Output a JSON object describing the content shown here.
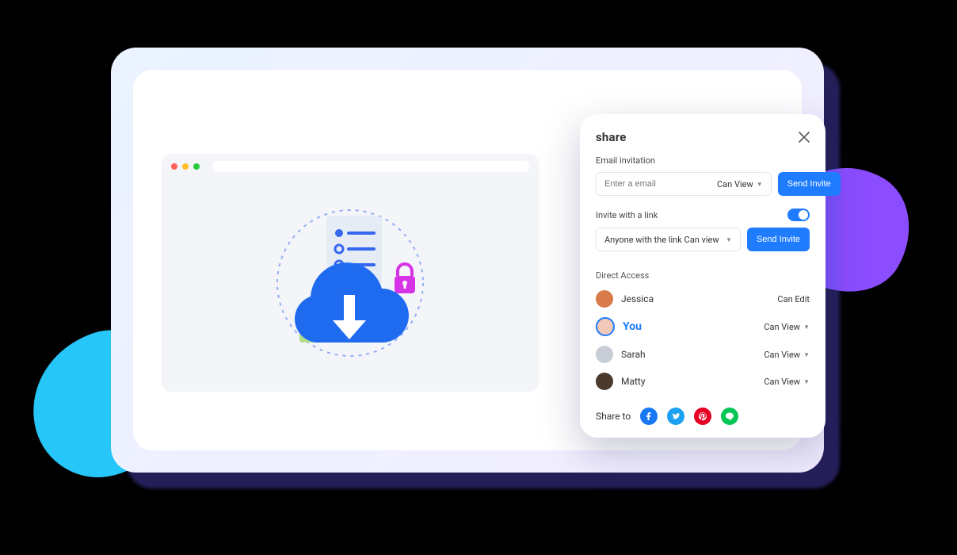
{
  "share": {
    "title": "share",
    "email_invitation_label": "Email invitation",
    "email_placeholder": "Enter a email",
    "email_perm": "Can View",
    "send_invite_label": "Send Invite",
    "invite_link_label": "Invite with a link",
    "link_select_text": "Anyone with the link Can view",
    "direct_access_label": "Direct Access",
    "people": [
      {
        "name": "Jessica",
        "perm": "Can Edit",
        "has_caret": false,
        "avatar_bg": "#D97A4A"
      },
      {
        "name": "You",
        "perm": "Can View",
        "has_caret": true,
        "avatar_bg": "#F2C8B8",
        "is_you": true
      },
      {
        "name": "Sarah",
        "perm": "Can View",
        "has_caret": true,
        "avatar_bg": "#C9CDD6"
      },
      {
        "name": "Matty",
        "perm": "Can View",
        "has_caret": true,
        "avatar_bg": "#4A3A2E"
      }
    ],
    "share_to_label": "Share to",
    "socials": [
      "facebook",
      "twitter",
      "pinterest",
      "line"
    ]
  }
}
